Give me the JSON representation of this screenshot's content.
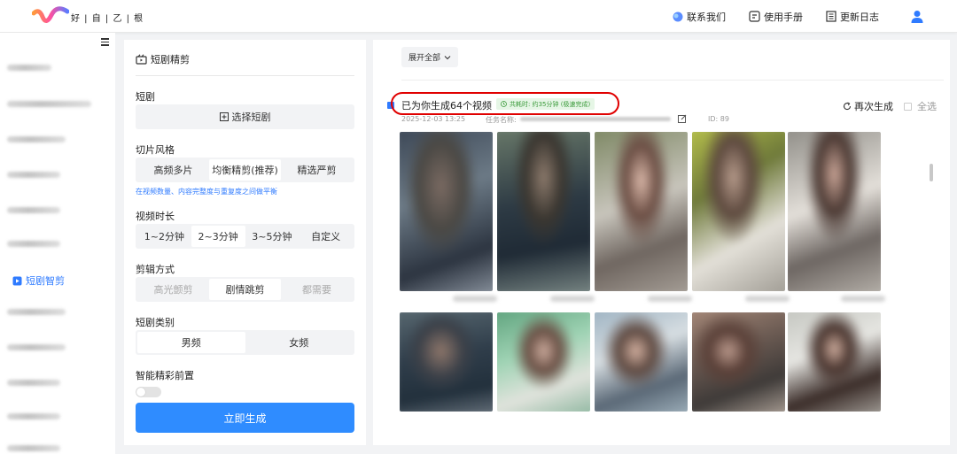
{
  "header": {
    "logo_text": "好 | 自 | 乙 | 根",
    "nav": [
      {
        "label": "联系我们",
        "icon": "chat-bubble-icon"
      },
      {
        "label": "使用手册",
        "icon": "manual-icon"
      },
      {
        "label": "更新日志",
        "icon": "changelog-icon"
      }
    ],
    "user_icon": "user-icon"
  },
  "sidebar": {
    "active_label": "短剧智剪",
    "blurred_item_count": 11
  },
  "config": {
    "title": "短剧精剪",
    "drama_label": "短剧",
    "select_drama_label": "选择短剧",
    "style_label": "切片风格",
    "style_options": [
      "高频多片",
      "均衡精剪(推荐)",
      "精选严剪"
    ],
    "style_selected": "均衡精剪(推荐)",
    "style_hint": "在视频数量、内容完整度与重复度之间做平衡",
    "duration_label": "视频时长",
    "duration_options": [
      "1~2分钟",
      "2~3分钟",
      "3~5分钟",
      "自定义"
    ],
    "duration_selected": "2~3分钟",
    "edit_label": "剪辑方式",
    "edit_options": [
      "高光颤剪",
      "剧情跳剪",
      "都需要"
    ],
    "edit_selected": "剧情跳剪",
    "category_label": "短剧类别",
    "category_options": [
      "男频",
      "女频"
    ],
    "category_selected": "男频",
    "smart_label": "智能精彩前置",
    "smart_enabled": false,
    "generate_label": "立即生成"
  },
  "results": {
    "expand_label": "展开全部",
    "title": "已为你生成64个视频",
    "time_badge": "共耗时: 约35分钟 (极速完成)",
    "date": "2025-12-03 13:25",
    "task_label": "任务名称:",
    "id_label": "ID: 89",
    "regen_label": "再次生成",
    "select_all_label": "全选"
  },
  "colors": {
    "accent": "#2f8cff",
    "link": "#2f7bff",
    "highlight_oval": "#e00000",
    "badge_bg": "#e6f6e6",
    "badge_text": "#3a9a3a"
  }
}
